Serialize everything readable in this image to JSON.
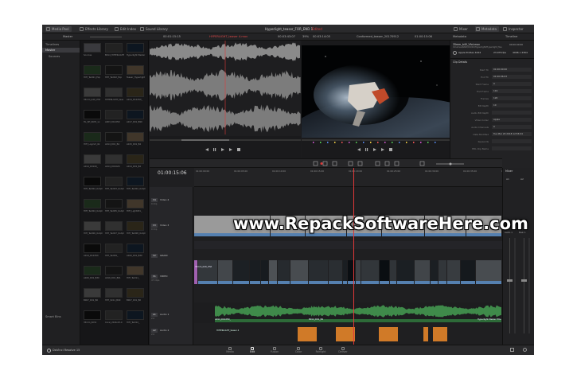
{
  "app": {
    "project_title": "Hyperlight_teaser_FOR_END 1",
    "project_status": "Edited",
    "brand": "DaVinci Resolve 15"
  },
  "top_tabs": {
    "left": [
      "Media Pool",
      "Effects Library",
      "Edit Index",
      "Sound Library"
    ],
    "right": [
      "Mixer",
      "Metadata",
      "Inspector"
    ]
  },
  "toolbar2": {
    "pool_name": "Master",
    "source_timecode": "00:01:15:15",
    "clip_name": "HYPERLIGHT_teaser 4.mov",
    "duration": "00:03:43:07",
    "zoom": "39%",
    "record_timecode": "00:03:14:05",
    "timeline_name": "Conformed_teaser_20170912",
    "timeline_timecode": "01:00:15:06",
    "metadata_label": "Metadata",
    "timeline_label": "Timeline"
  },
  "sidebar": {
    "items": [
      "Timelines",
      "Master",
      "Sources"
    ],
    "smart_bins": "Smart Bins"
  },
  "media_pool": {
    "clips": [
      "Sources",
      "B014_HYPERLIGHT_",
      "Hyperlight Master",
      "HYP_Text01_Exp",
      "HYP_Text02_Exp",
      "Teaser_Hyperlight",
      "35mm_b40_Vfxt",
      "HYPERLIGHT_teas",
      "A014_D1025D_",
      "HL_SH_0670_xx",
      "A003_D1025D",
      "A017_D01_B90",
      "HYP_LogoV1_6k",
      "A014_D01_B4",
      "A015_D01_B4",
      "A014_D0100_",
      "A014_D0102D",
      "A014_D01_B4",
      "HYP_Text02_Outpt",
      "HYP_Text03_Outpt",
      "HYP_Text02_Outpt",
      "HYP_Text04_Outpt",
      "HYP_Text05_Outpt",
      "HYP_LightV01_",
      "HYP_Text06_Outpt",
      "HYP_Text07_Outpt",
      "HYP_Text08_Outpt",
      "A014_D1025D",
      "HYP_Text09_",
      "A020_D01_B30",
      "A020_D01_B30",
      "A016_D01_B01",
      "HYP_Text11_",
      "B007_D01_B0",
      "HYP_S011_B00",
      "B007_D01_B0",
      "35mm_S031",
      "Coral_2016-03-0",
      "HYP_Text12_"
    ]
  },
  "inspector": {
    "file_name": "35mm_b40_Vfxt.mov",
    "file_path": "Volumes/RAID/CO/01/Hyperlight/Hyperlight_Tea",
    "codec": "Apple ProRes 4444",
    "file_timecode": "00:00:00:00",
    "fps": "23.976 fps",
    "resolution": "4096 x 2304",
    "section": "Clip Details",
    "rows": [
      {
        "key": "Start TC",
        "value": "01:00:00:00"
      },
      {
        "key": "End TC",
        "value": "01:00:06:03"
      },
      {
        "key": "Start Frame",
        "value": "0"
      },
      {
        "key": "End Frame",
        "value": "119"
      },
      {
        "key": "Frames",
        "value": "120"
      },
      {
        "key": "Bit Depth",
        "value": "10"
      },
      {
        "key": "Audio Bit Depth",
        "value": ""
      },
      {
        "key": "Video Codec",
        "value": "Apple"
      },
      {
        "key": "Audio Channels",
        "value": "0"
      },
      {
        "key": "Date Modified",
        "value": "Tue Mar 20 2018 12:55:04"
      },
      {
        "key": "Keywords",
        "value": ""
      },
      {
        "key": "EDL Clip Name",
        "value": ""
      }
    ]
  },
  "timeline": {
    "timecode": "01:00:15:06",
    "ruler": [
      "01:00:00:00",
      "01:00:05:00",
      "01:00:10:00",
      "01:00:15:00",
      "01:00:20:00",
      "01:00:25:00",
      "01:00:30:00",
      "01:00:35:00",
      "01:00:40:00",
      "01:00:45:00"
    ],
    "tracks": [
      {
        "tag": "V4",
        "name": "Video 4",
        "info": "0 Clip"
      },
      {
        "tag": "V3",
        "name": "Video 3",
        "info": "0 Clip"
      },
      {
        "tag": "V2",
        "name": "GRAIN",
        "info": ""
      },
      {
        "tag": "V1",
        "name": "VIDEO",
        "info": "47 Clips"
      },
      {
        "tag": "A1",
        "name": "Audio 1",
        "info": "2.0"
      },
      {
        "tag": "A2",
        "name": "Audio 2",
        "info": "2.0"
      }
    ],
    "clip_labels": {
      "v3": "35mm_b40_Vfxt",
      "v1_a": "A014_D1025D_",
      "v1_b": "B014_D01_B4",
      "v1_end": "Hyperlight Master Title",
      "a1": "HYPERLIGHT_teaser 4"
    }
  },
  "mixer": {
    "title": "Mixer",
    "channels": [
      "A1",
      "A2"
    ],
    "buses": [
      "Audio 1",
      "Main 1"
    ]
  },
  "pages": [
    "Media",
    "Edit",
    "Fusion",
    "Color",
    "Fairlight",
    "Deliver"
  ],
  "active_page": "Edit",
  "watermark": "www.RepackSoftwareHere.com",
  "colors": {
    "accent": "#e03838",
    "clip_blue": "#5580b0",
    "audio_green": "#3f8a4a",
    "audio_orange": "#d07a28"
  }
}
